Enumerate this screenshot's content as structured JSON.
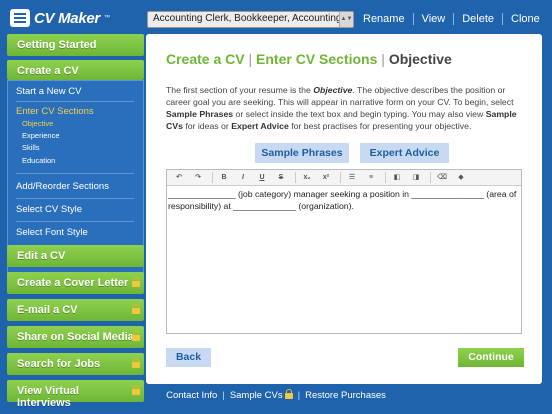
{
  "app": {
    "title": "CV Maker",
    "tm": "™"
  },
  "topbar": {
    "selected_cv": "Accounting Clerk, Bookkeeper, Accounting Assista",
    "actions": [
      "Rename",
      "View",
      "Delete",
      "Clone"
    ]
  },
  "sidebar": {
    "getting_started": "Getting Started",
    "create_cv": "Create a CV",
    "start_new": "Start a New CV",
    "enter_sections": "Enter CV Sections",
    "sections": [
      "Objective",
      "Experience",
      "Skills",
      "Education"
    ],
    "add_reorder": "Add/Reorder Sections",
    "select_style": "Select CV Style",
    "select_font": "Select Font Style",
    "edit_cv": "Edit a CV",
    "cover_letter": "Create a Cover Letter",
    "email_cv": "E-mail a CV",
    "share_social": "Share on Social Media",
    "search_jobs": "Search for Jobs",
    "virtual_interviews": "View Virtual Interviews"
  },
  "main": {
    "crumb1": "Create a CV",
    "crumb2": "Enter CV Sections",
    "crumb3": "Objective",
    "crumb_sep": "|",
    "intro": {
      "p1": "The first section of your resume is the ",
      "objective": "Objective",
      "p2": ". The objective describes the position or career goal you are seeking. This will appear in narrative form on your CV. To begin, select ",
      "sample_phrases": "Sample Phrases",
      "p3": " or select inside the text box and begin typing. You may also view ",
      "sample_cvs": "Sample CVs",
      "p4": " for ideas or ",
      "expert_advice": "Expert Advice",
      "p5": " for best practises for presenting your objective."
    },
    "sample_phrases_button": "Sample Phrases",
    "expert_advice_button": "Expert Advice",
    "editor_text": "______________ (job category) manager seeking a position in _______________ (area of responsibility) at _____________ (organization).",
    "back_button": "Back",
    "continue_button": "Continue"
  },
  "toolbar_buttons": [
    "undo",
    "redo",
    "B",
    "I",
    "U",
    "S",
    "x₂",
    "x²",
    "ol",
    "ul",
    "outdent",
    "indent",
    "clear",
    "source"
  ],
  "footer": {
    "contact": "Contact Info",
    "sample_cvs": "Sample CVs",
    "restore": "Restore Purchases"
  },
  "colors": {
    "brand_blue": "#1f63ad",
    "green": "#6fb636",
    "highlight": "#f6cf4f"
  }
}
